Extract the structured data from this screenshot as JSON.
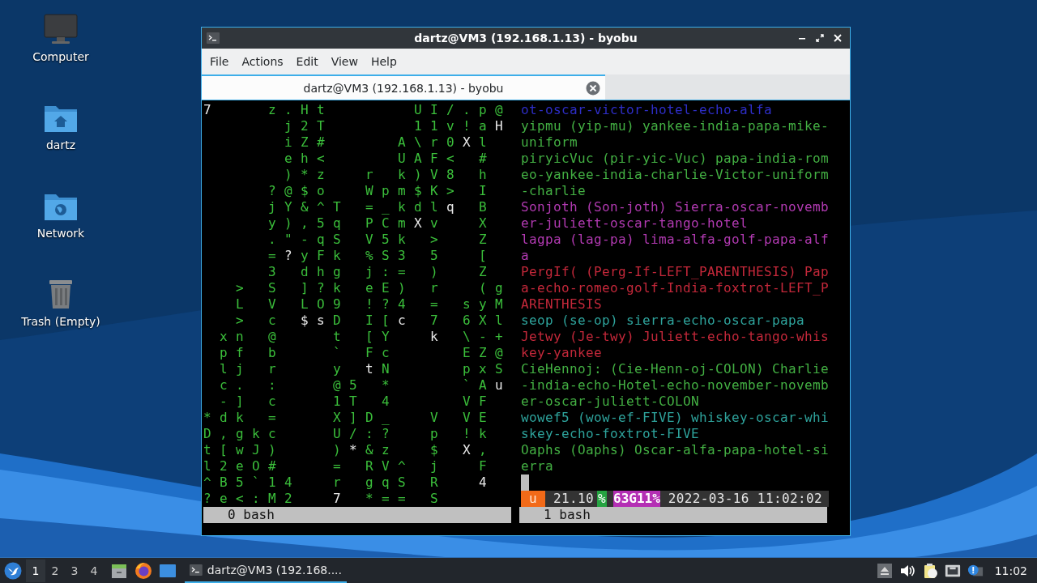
{
  "desktop_icons": [
    {
      "label": "Computer",
      "kind": "computer"
    },
    {
      "label": "dartz",
      "kind": "home"
    },
    {
      "label": "Network",
      "kind": "network"
    },
    {
      "label": "Trash (Empty)",
      "kind": "trash"
    }
  ],
  "window": {
    "title": "dartz@VM3 (192.168.1.13) - byobu",
    "menu": [
      "File",
      "Actions",
      "Edit",
      "View",
      "Help"
    ],
    "tabs": [
      {
        "label": "dartz@VM3 (192.168.1.13) - byobu",
        "selected": true
      }
    ],
    "left_pane": {
      "rows": [
        [
          {
            "char": "7",
            "bright": true
          },
          null,
          null,
          null,
          {
            "char": "z",
            "bright": false
          },
          {
            "char": ".",
            "bright": false
          },
          {
            "char": "H",
            "bright": false
          },
          {
            "char": "t",
            "bright": false
          },
          null,
          null,
          null,
          null,
          null,
          {
            "char": "U",
            "bright": false
          },
          {
            "char": "I",
            "bright": false
          },
          {
            "char": "/",
            "bright": false
          },
          {
            "char": ".",
            "bright": false
          },
          {
            "char": "p",
            "bright": false
          },
          {
            "char": "@",
            "bright": false
          }
        ],
        [
          null,
          null,
          null,
          null,
          null,
          {
            "char": "j",
            "bright": false
          },
          {
            "char": "2",
            "bright": false
          },
          {
            "char": "T",
            "bright": false
          },
          null,
          null,
          null,
          null,
          null,
          {
            "char": "1",
            "bright": false
          },
          {
            "char": "1",
            "bright": false
          },
          {
            "char": "v",
            "bright": false
          },
          {
            "char": "!",
            "bright": false
          },
          {
            "char": "a",
            "bright": false
          },
          {
            "char": "H",
            "bright": true
          }
        ],
        [
          null,
          null,
          null,
          null,
          null,
          {
            "char": "i",
            "bright": false
          },
          {
            "char": "Z",
            "bright": false
          },
          {
            "char": "#",
            "bright": false
          },
          null,
          null,
          null,
          null,
          {
            "char": "A",
            "bright": false
          },
          {
            "char": "\\",
            "bright": false
          },
          {
            "char": "r",
            "bright": false
          },
          {
            "char": "0",
            "bright": false
          },
          {
            "char": "X",
            "bright": true
          },
          {
            "char": "l",
            "bright": false
          }
        ],
        [
          null,
          null,
          null,
          null,
          null,
          {
            "char": "e",
            "bright": false
          },
          {
            "char": "h",
            "bright": false
          },
          {
            "char": "<",
            "bright": false
          },
          null,
          null,
          null,
          null,
          {
            "char": "U",
            "bright": false
          },
          {
            "char": "A",
            "bright": false
          },
          {
            "char": "F",
            "bright": false
          },
          {
            "char": "<",
            "bright": false
          },
          null,
          {
            "char": "#",
            "bright": false
          }
        ],
        [
          null,
          null,
          null,
          null,
          null,
          {
            "char": ")",
            "bright": false
          },
          {
            "char": "*",
            "bright": false
          },
          {
            "char": "z",
            "bright": false
          },
          null,
          null,
          {
            "char": "r",
            "bright": false
          },
          null,
          {
            "char": "k",
            "bright": false
          },
          {
            "char": ")",
            "bright": false
          },
          {
            "char": "V",
            "bright": false
          },
          {
            "char": "8",
            "bright": false
          },
          null,
          {
            "char": "h",
            "bright": false
          }
        ],
        [
          null,
          null,
          null,
          null,
          {
            "char": "?",
            "bright": false
          },
          {
            "char": "@",
            "bright": false
          },
          {
            "char": "$",
            "bright": false
          },
          {
            "char": "o",
            "bright": false
          },
          null,
          null,
          {
            "char": "W",
            "bright": false
          },
          {
            "char": "p",
            "bright": false
          },
          {
            "char": "m",
            "bright": false
          },
          {
            "char": "$",
            "bright": false
          },
          {
            "char": "K",
            "bright": false
          },
          {
            "char": ">",
            "bright": false
          },
          null,
          {
            "char": "I",
            "bright": false
          }
        ],
        [
          null,
          null,
          null,
          null,
          {
            "char": "j",
            "bright": false
          },
          {
            "char": "Y",
            "bright": false
          },
          {
            "char": "&",
            "bright": false
          },
          {
            "char": "^",
            "bright": false
          },
          {
            "char": "T",
            "bright": false
          },
          null,
          {
            "char": "=",
            "bright": false
          },
          {
            "char": "_",
            "bright": false
          },
          {
            "char": "k",
            "bright": false
          },
          {
            "char": "d",
            "bright": false
          },
          {
            "char": "l",
            "bright": false
          },
          {
            "char": "q",
            "bright": true
          },
          null,
          {
            "char": "B",
            "bright": false
          }
        ],
        [
          null,
          null,
          null,
          null,
          {
            "char": "y",
            "bright": false
          },
          {
            "char": ")",
            "bright": false
          },
          {
            "char": ",",
            "bright": false
          },
          {
            "char": "5",
            "bright": false
          },
          {
            "char": "q",
            "bright": false
          },
          null,
          {
            "char": "P",
            "bright": false
          },
          {
            "char": "C",
            "bright": false
          },
          {
            "char": "m",
            "bright": false
          },
          {
            "char": "X",
            "bright": true
          },
          {
            "char": "v",
            "bright": false
          },
          null,
          null,
          {
            "char": "X",
            "bright": false
          }
        ],
        [
          null,
          null,
          null,
          null,
          {
            "char": ".",
            "bright": false
          },
          {
            "char": "\"",
            "bright": false
          },
          {
            "char": "-",
            "bright": false
          },
          {
            "char": "q",
            "bright": false
          },
          {
            "char": "S",
            "bright": false
          },
          null,
          {
            "char": "V",
            "bright": false
          },
          {
            "char": "5",
            "bright": false
          },
          {
            "char": "k",
            "bright": false
          },
          null,
          {
            "char": ">",
            "bright": false
          },
          null,
          null,
          {
            "char": "Z",
            "bright": false
          }
        ],
        [
          null,
          null,
          null,
          null,
          {
            "char": "=",
            "bright": false
          },
          {
            "char": "?",
            "bright": true
          },
          {
            "char": "y",
            "bright": false
          },
          {
            "char": "F",
            "bright": false
          },
          {
            "char": "k",
            "bright": false
          },
          null,
          {
            "char": "%",
            "bright": false
          },
          {
            "char": "S",
            "bright": false
          },
          {
            "char": "3",
            "bright": false
          },
          null,
          {
            "char": "5",
            "bright": false
          },
          null,
          null,
          {
            "char": "[",
            "bright": false
          }
        ],
        [
          null,
          null,
          null,
          null,
          {
            "char": "3",
            "bright": false
          },
          null,
          {
            "char": "d",
            "bright": false
          },
          {
            "char": "h",
            "bright": false
          },
          {
            "char": "g",
            "bright": false
          },
          null,
          {
            "char": "j",
            "bright": false
          },
          {
            "char": ":",
            "bright": false
          },
          {
            "char": "=",
            "bright": false
          },
          null,
          {
            "char": ")",
            "bright": false
          },
          null,
          null,
          {
            "char": "Z",
            "bright": false
          }
        ],
        [
          null,
          null,
          {
            "char": ">",
            "bright": false
          },
          null,
          {
            "char": "S",
            "bright": false
          },
          null,
          {
            "char": "]",
            "bright": false
          },
          {
            "char": "?",
            "bright": false
          },
          {
            "char": "k",
            "bright": false
          },
          null,
          {
            "char": "e",
            "bright": false
          },
          {
            "char": "E",
            "bright": false
          },
          {
            "char": ")",
            "bright": false
          },
          null,
          {
            "char": "r",
            "bright": false
          },
          null,
          null,
          {
            "char": "(",
            "bright": false
          },
          {
            "char": "g",
            "bright": false
          }
        ],
        [
          null,
          null,
          {
            "char": "L",
            "bright": false
          },
          null,
          {
            "char": "V",
            "bright": false
          },
          null,
          {
            "char": "L",
            "bright": false
          },
          {
            "char": "O",
            "bright": false
          },
          {
            "char": "9",
            "bright": false
          },
          null,
          {
            "char": "!",
            "bright": false
          },
          {
            "char": "?",
            "bright": false
          },
          {
            "char": "4",
            "bright": false
          },
          null,
          {
            "char": "=",
            "bright": false
          },
          null,
          {
            "char": "s",
            "bright": false
          },
          {
            "char": "y",
            "bright": false
          },
          {
            "char": "M",
            "bright": false
          }
        ],
        [
          null,
          null,
          {
            "char": ">",
            "bright": false
          },
          null,
          {
            "char": "c",
            "bright": false
          },
          null,
          {
            "char": "$",
            "bright": true
          },
          {
            "char": "s",
            "bright": true
          },
          {
            "char": "D",
            "bright": false
          },
          null,
          {
            "char": "I",
            "bright": false
          },
          {
            "char": "[",
            "bright": false
          },
          {
            "char": "c",
            "bright": true
          },
          null,
          {
            "char": "7",
            "bright": false
          },
          null,
          {
            "char": "6",
            "bright": false
          },
          {
            "char": "X",
            "bright": false
          },
          {
            "char": "l",
            "bright": false
          }
        ],
        [
          null,
          {
            "char": "x",
            "bright": false
          },
          {
            "char": "n",
            "bright": false
          },
          null,
          {
            "char": "@",
            "bright": false
          },
          null,
          null,
          null,
          {
            "char": "t",
            "bright": false
          },
          null,
          {
            "char": "[",
            "bright": false
          },
          {
            "char": "Y",
            "bright": false
          },
          null,
          null,
          {
            "char": "k",
            "bright": true
          },
          null,
          {
            "char": "\\",
            "bright": false
          },
          {
            "char": "-",
            "bright": false
          },
          {
            "char": "+",
            "bright": false
          }
        ],
        [
          null,
          {
            "char": "p",
            "bright": false
          },
          {
            "char": "f",
            "bright": false
          },
          null,
          {
            "char": "b",
            "bright": false
          },
          null,
          null,
          null,
          {
            "char": "`",
            "bright": false
          },
          null,
          {
            "char": "F",
            "bright": false
          },
          {
            "char": "c",
            "bright": false
          },
          null,
          null,
          null,
          null,
          {
            "char": "E",
            "bright": false
          },
          {
            "char": "Z",
            "bright": false
          },
          {
            "char": "@",
            "bright": false
          }
        ],
        [
          null,
          {
            "char": "l",
            "bright": false
          },
          {
            "char": "j",
            "bright": false
          },
          null,
          {
            "char": "r",
            "bright": false
          },
          null,
          null,
          null,
          {
            "char": "y",
            "bright": false
          },
          null,
          {
            "char": "t",
            "bright": true
          },
          {
            "char": "N",
            "bright": false
          },
          null,
          null,
          null,
          null,
          {
            "char": "p",
            "bright": false
          },
          {
            "char": "x",
            "bright": false
          },
          {
            "char": "S",
            "bright": false
          }
        ],
        [
          null,
          {
            "char": "c",
            "bright": false
          },
          {
            "char": ".",
            "bright": false
          },
          null,
          {
            "char": ":",
            "bright": false
          },
          null,
          null,
          null,
          {
            "char": "@",
            "bright": false
          },
          {
            "char": "5",
            "bright": false
          },
          null,
          {
            "char": "*",
            "bright": false
          },
          null,
          null,
          null,
          null,
          {
            "char": "`",
            "bright": false
          },
          {
            "char": "A",
            "bright": false
          },
          {
            "char": "u",
            "bright": true
          }
        ],
        [
          null,
          {
            "char": "-",
            "bright": false
          },
          {
            "char": "]",
            "bright": false
          },
          null,
          {
            "char": "c",
            "bright": false
          },
          null,
          null,
          null,
          {
            "char": "1",
            "bright": false
          },
          {
            "char": "T",
            "bright": false
          },
          null,
          {
            "char": "4",
            "bright": false
          },
          null,
          null,
          null,
          null,
          {
            "char": "V",
            "bright": false
          },
          {
            "char": "F",
            "bright": false
          }
        ],
        [
          {
            "char": "*",
            "bright": false
          },
          {
            "char": "d",
            "bright": false
          },
          {
            "char": "k",
            "bright": false
          },
          null,
          {
            "char": "=",
            "bright": false
          },
          null,
          null,
          null,
          {
            "char": "X",
            "bright": false
          },
          {
            "char": "]",
            "bright": false
          },
          {
            "char": "D",
            "bright": false
          },
          {
            "char": "_",
            "bright": false
          },
          null,
          null,
          {
            "char": "V",
            "bright": false
          },
          null,
          {
            "char": "V",
            "bright": false
          },
          {
            "char": "E",
            "bright": false
          }
        ],
        [
          {
            "char": "D",
            "bright": false
          },
          {
            "char": ",",
            "bright": false
          },
          {
            "char": "g",
            "bright": false
          },
          {
            "char": "k",
            "bright": false
          },
          {
            "char": "c",
            "bright": false
          },
          null,
          null,
          null,
          {
            "char": "U",
            "bright": false
          },
          {
            "char": "/",
            "bright": false
          },
          {
            "char": ":",
            "bright": false
          },
          {
            "char": "?",
            "bright": false
          },
          null,
          null,
          {
            "char": "p",
            "bright": false
          },
          null,
          {
            "char": "!",
            "bright": false
          },
          {
            "char": "k",
            "bright": false
          }
        ],
        [
          {
            "char": "t",
            "bright": false
          },
          {
            "char": "[",
            "bright": false
          },
          {
            "char": "w",
            "bright": false
          },
          {
            "char": "J",
            "bright": false
          },
          {
            "char": ")",
            "bright": false
          },
          null,
          null,
          null,
          {
            "char": ")",
            "bright": false
          },
          {
            "char": "*",
            "bright": true
          },
          {
            "char": "&",
            "bright": false
          },
          {
            "char": "z",
            "bright": false
          },
          null,
          null,
          {
            "char": "$",
            "bright": false
          },
          null,
          {
            "char": "X",
            "bright": true
          },
          {
            "char": ",",
            "bright": false
          }
        ],
        [
          {
            "char": "l",
            "bright": false
          },
          {
            "char": "2",
            "bright": false
          },
          {
            "char": "e",
            "bright": false
          },
          {
            "char": "O",
            "bright": false
          },
          {
            "char": "#",
            "bright": false
          },
          null,
          null,
          null,
          {
            "char": "=",
            "bright": false
          },
          null,
          {
            "char": "R",
            "bright": false
          },
          {
            "char": "V",
            "bright": false
          },
          {
            "char": "^",
            "bright": false
          },
          null,
          {
            "char": "j",
            "bright": false
          },
          null,
          null,
          {
            "char": "F",
            "bright": false
          }
        ],
        [
          {
            "char": "^",
            "bright": false
          },
          {
            "char": "B",
            "bright": false
          },
          {
            "char": "5",
            "bright": false
          },
          {
            "char": "`",
            "bright": false
          },
          {
            "char": "1",
            "bright": false
          },
          {
            "char": "4",
            "bright": false
          },
          null,
          null,
          {
            "char": "r",
            "bright": false
          },
          null,
          {
            "char": "g",
            "bright": false
          },
          {
            "char": "q",
            "bright": false
          },
          {
            "char": "S",
            "bright": false
          },
          null,
          {
            "char": "R",
            "bright": false
          },
          null,
          null,
          {
            "char": "4",
            "bright": true
          }
        ],
        [
          {
            "char": "?",
            "bright": false
          },
          {
            "char": "e",
            "bright": false
          },
          {
            "char": "<",
            "bright": false
          },
          {
            "char": ":",
            "bright": false
          },
          {
            "char": "M",
            "bright": false
          },
          {
            "char": "2",
            "bright": false
          },
          null,
          null,
          {
            "char": "7",
            "bright": true
          },
          null,
          {
            "char": "*",
            "bright": false
          },
          {
            "char": "=",
            "bright": false
          },
          {
            "char": "=",
            "bright": false
          },
          null,
          {
            "char": "S",
            "bright": false
          }
        ]
      ],
      "label": "0 bash"
    },
    "right_pane": {
      "lines": [
        {
          "text": "ot-oscar-victor-hotel-echo-alfa",
          "color": "#2e2ec8"
        },
        {
          "text": "yipmu (yip-mu) yankee-india-papa-mike-uniform",
          "color": "#43b043"
        },
        {
          "text": "piryicVuc (pir-yic-Vuc) papa-india-romeo-yankee-india-charlie-Victor-uniform-charlie",
          "color": "#43b043"
        },
        {
          "text": "Sonjoth (Son-joth) Sierra-oscar-november-juliett-oscar-tango-hotel",
          "color": "#b23ab2"
        },
        {
          "text": "lagpa (lag-pa) lima-alfa-golf-papa-alfa",
          "color": "#b23ab2"
        },
        {
          "text": "PergIf( (Perg-If-LEFT_PARENTHESIS) Papa-echo-romeo-golf-India-foxtrot-LEFT_PARENTHESIS",
          "color": "#c4283a"
        },
        {
          "text": "seop (se-op) sierra-echo-oscar-papa",
          "color": "#2ea39c"
        },
        {
          "text": "Jetwy (Je-twy) Juliett-echo-tango-whiskey-yankee",
          "color": "#c4283a"
        },
        {
          "text": "CieHennoj: (Cie-Henn-oj-COLON) Charlie-india-echo-Hotel-echo-november-november-oscar-juliett-COLON",
          "color": "#43b043"
        },
        {
          "text": "wowef5 (wow-ef-FIVE) whiskey-oscar-whiskey-echo-foxtrot-FIVE",
          "color": "#2ea39c"
        },
        {
          "text": "Oaphs (Oaphs) Oscar-alfa-papa-hotel-sierra",
          "color": "#43b043"
        }
      ],
      "status": [
        {
          "text": "u",
          "kind": "session"
        },
        {
          "text": "21.10",
          "kind": "load"
        },
        {
          "text": "%",
          "kind": "cpu"
        },
        {
          "text": "63G11%",
          "kind": "memory"
        },
        {
          "text": "2022-03-16 11:02:02",
          "kind": "clock"
        }
      ],
      "label": "1 bash"
    }
  },
  "taskbar": {
    "workspaces": [
      {
        "label": "1",
        "selected": true
      },
      {
        "label": "2",
        "selected": false
      },
      {
        "label": "3",
        "selected": false
      },
      {
        "label": "4",
        "selected": false
      }
    ],
    "tasks": [
      {
        "label": "dartz@VM3 (192.168....",
        "selected": true
      }
    ],
    "clock": "11:02"
  }
}
